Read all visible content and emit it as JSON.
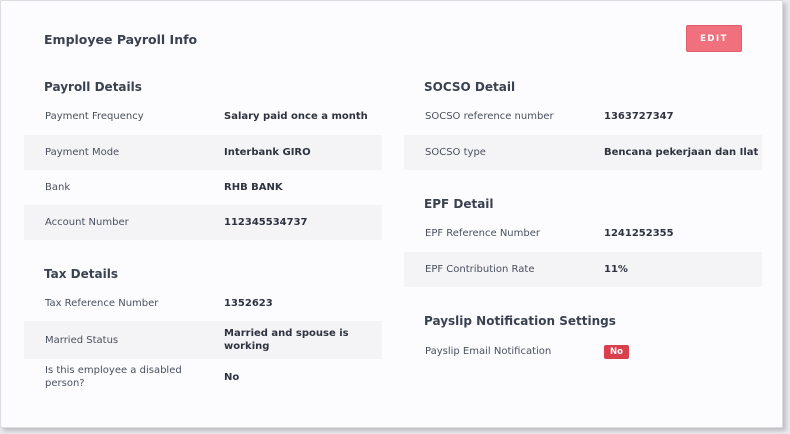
{
  "header": {
    "title": "Employee Payroll Info",
    "edit_label": "EDIT"
  },
  "payroll": {
    "title": "Payroll Details",
    "rows": [
      {
        "label": "Payment Frequency",
        "value": "Salary paid once a month"
      },
      {
        "label": "Payment Mode",
        "value": "Interbank GIRO"
      },
      {
        "label": "Bank",
        "value": "RHB BANK"
      },
      {
        "label": "Account Number",
        "value": "112345534737"
      }
    ]
  },
  "tax": {
    "title": "Tax Details",
    "rows": [
      {
        "label": "Tax Reference Number",
        "value": "1352623"
      },
      {
        "label": "Married Status",
        "value": "Married and spouse is working"
      },
      {
        "label": "Is this employee a disabled person?",
        "value": "No"
      }
    ]
  },
  "socso": {
    "title": "SOCSO Detail",
    "rows": [
      {
        "label": "SOCSO reference number",
        "value": "1363727347"
      },
      {
        "label": "SOCSO type",
        "value": "Bencana pekerjaan dan Ilat"
      }
    ]
  },
  "epf": {
    "title": "EPF Detail",
    "rows": [
      {
        "label": "EPF Reference Number",
        "value": "1241252355"
      },
      {
        "label": "EPF Contribution Rate",
        "value": "11%"
      }
    ]
  },
  "payslip": {
    "title": "Payslip Notification Settings",
    "rows": [
      {
        "label": "Payslip Email Notification",
        "value": "No"
      }
    ]
  },
  "colors": {
    "accent": "#f0707e",
    "badge": "#d9404e",
    "row_shade": "#f4f4f6"
  }
}
